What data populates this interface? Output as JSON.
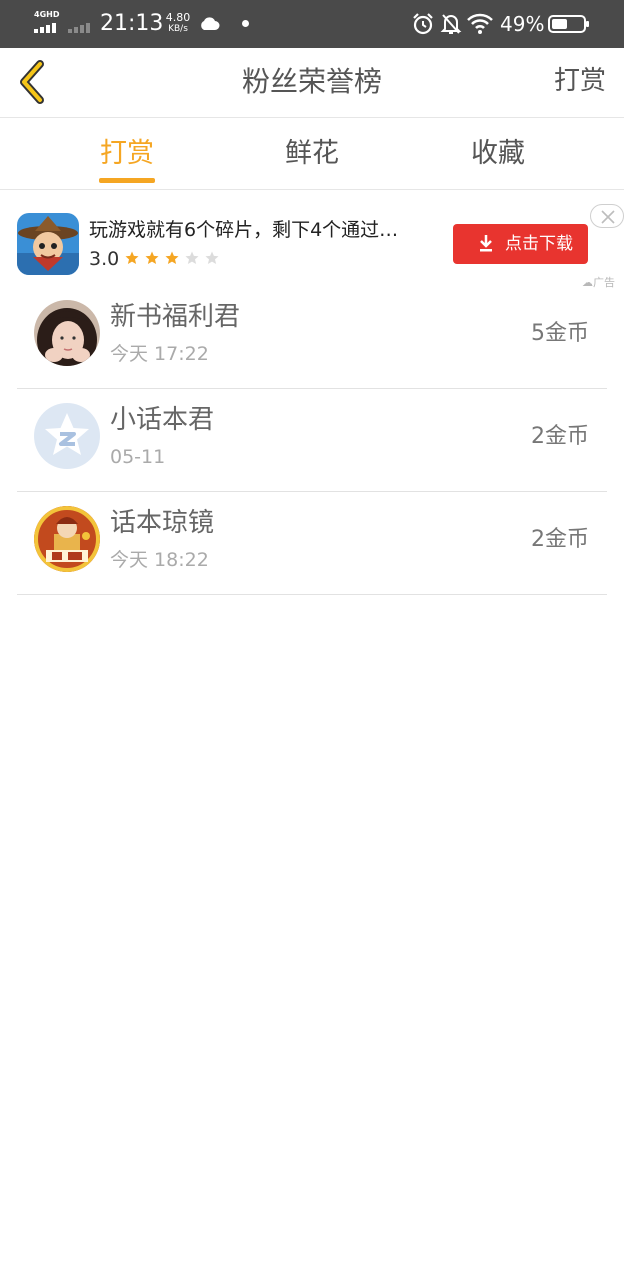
{
  "status_bar": {
    "network": "4GHD",
    "time": "21:13",
    "speed_value": "4.80",
    "speed_unit": "KB/s",
    "battery_percent": "49%",
    "battery_level": 0.49
  },
  "header": {
    "title": "粉丝荣誉榜",
    "action_label": "打赏",
    "accent_color": "#f5a623"
  },
  "tabs": [
    {
      "label": "打赏",
      "active": true
    },
    {
      "label": "鲜花",
      "active": false
    },
    {
      "label": "收藏",
      "active": false
    }
  ],
  "ad": {
    "title": "玩游戏就有6个碎片，剩下4个通过…",
    "rating": "3.0",
    "stars_filled": 3,
    "stars_total": 5,
    "download_label": "点击下载",
    "button_color": "#e8342f",
    "tag": "广告"
  },
  "supporters": [
    {
      "name": "新书福利君",
      "time": "今天 17:22",
      "amount": "5金币",
      "avatar": "photo-avatar"
    },
    {
      "name": "小话本君",
      "time": "05-11",
      "amount": "2金币",
      "avatar": "default-avatar"
    },
    {
      "name": "话本琼镜",
      "time": "今天 18:22",
      "amount": "2金币",
      "avatar": "illustrated-avatar"
    }
  ]
}
